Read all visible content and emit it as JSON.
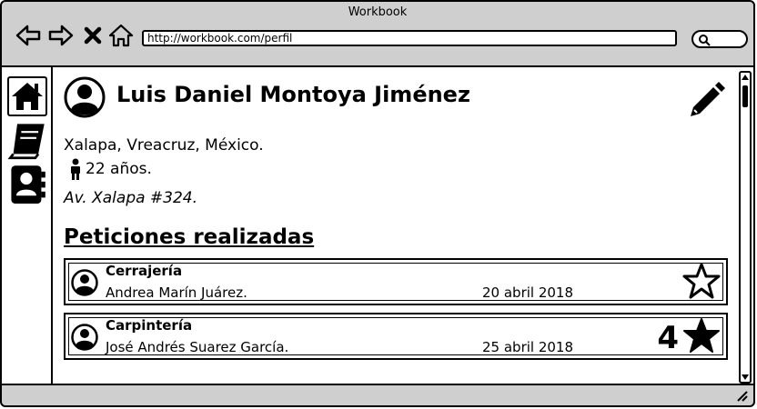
{
  "window": {
    "title": "Workbook"
  },
  "browser": {
    "url": "http://workbook.com/perfil"
  },
  "profile": {
    "name": "Luis Daniel Montoya Jiménez",
    "location": "Xalapa, Vreacruz, México.",
    "age": "22 años.",
    "address": "Av. Xalapa #324."
  },
  "section": {
    "title": "Peticiones realizadas"
  },
  "requests": [
    {
      "service": "Cerrajería",
      "person": "Andrea Marín Juárez.",
      "date": "20 abril 2018",
      "rating": "",
      "star": "outline"
    },
    {
      "service": "Carpintería",
      "person": "José Andrés Suarez García.",
      "date": "25 abril 2018",
      "rating": "4",
      "star": "filled"
    }
  ],
  "icons": {
    "back": "back-arrow-icon",
    "forward": "forward-arrow-icon",
    "close": "close-icon",
    "home": "home-icon",
    "search": "search-icon",
    "edit": "pencil-icon",
    "person": "person-icon",
    "book": "book-icon",
    "contacts": "contacts-icon",
    "star_outline": "star-outline-icon",
    "star_filled": "star-filled-icon"
  }
}
